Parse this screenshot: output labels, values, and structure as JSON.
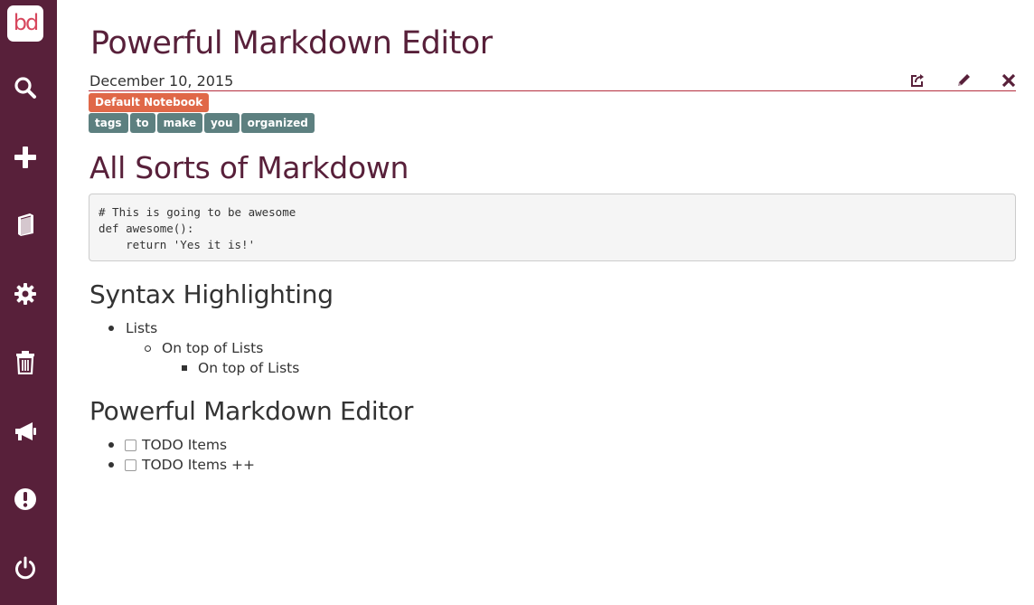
{
  "sidebar": {
    "logo": "bd",
    "items": [
      {
        "icon": "search-icon"
      },
      {
        "icon": "plus-icon"
      },
      {
        "icon": "notebook-icon"
      },
      {
        "icon": "gear-icon"
      },
      {
        "icon": "trash-icon"
      },
      {
        "icon": "megaphone-icon"
      },
      {
        "icon": "alert-icon"
      },
      {
        "icon": "power-icon"
      }
    ],
    "background": "#58203a"
  },
  "note": {
    "title": "Powerful Markdown Editor",
    "date": "December 10, 2015",
    "notebook": "Default Notebook",
    "tags": [
      "tags",
      "to",
      "make",
      "you",
      "organized"
    ],
    "actions": [
      "share-icon",
      "edit-icon",
      "close-icon"
    ]
  },
  "content": {
    "heading1": "All Sorts of Markdown",
    "code_lines": [
      "# This is going to be awesome",
      "def awesome():",
      "    return 'Yes it is!'"
    ],
    "heading2": "Syntax Highlighting",
    "list": {
      "level1": "Lists",
      "level2": "On top of Lists",
      "level3": "On top of Lists"
    },
    "heading3": "Powerful Markdown Editor",
    "todos": [
      {
        "label": "TODO Items",
        "checked": false
      },
      {
        "label": "TODO Items ++",
        "checked": false
      }
    ]
  },
  "colors": {
    "accent": "#58203a",
    "notebook_badge": "#e06848",
    "tag_badge": "#5d8080",
    "rule": "#b5303f"
  }
}
